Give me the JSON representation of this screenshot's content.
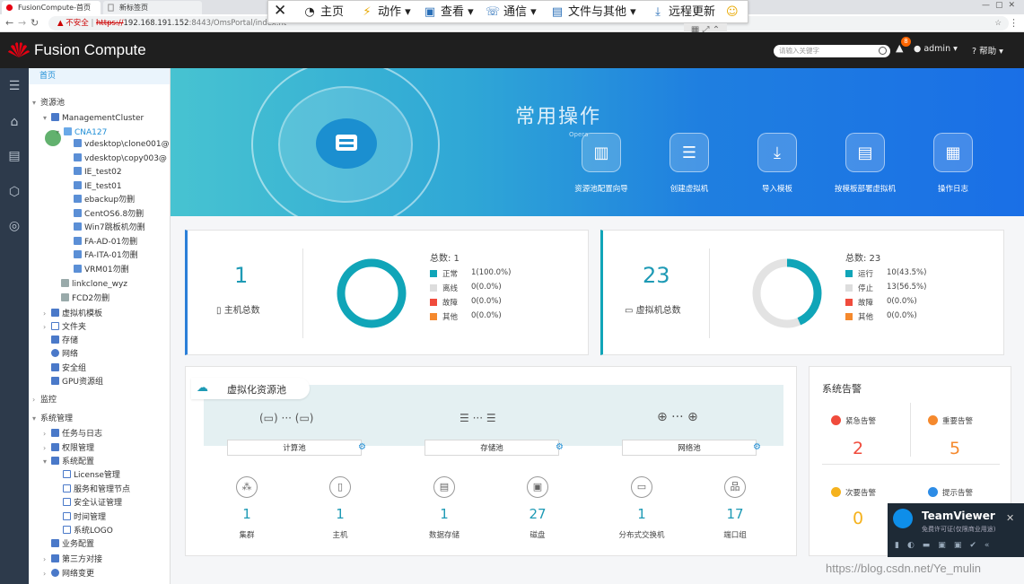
{
  "browser": {
    "tab1": "FusionCompute-首页",
    "tab2": "新标签页",
    "insecure": "不安全",
    "url_scheme": "https://",
    "url_host": "192.168.191.152",
    "url_rest": ":8443/OmsPortal/index.ht"
  },
  "remote_toolbar": {
    "home": "主页",
    "action": "动作",
    "view": "查看",
    "comm": "通信",
    "files": "文件与其他",
    "update": "远程更新"
  },
  "header": {
    "logo": "Fusion Compute",
    "search_placeholder": "请输入关键字",
    "alert_count": "8",
    "user": "admin",
    "help": "帮助"
  },
  "sidebar": {
    "home": "首页",
    "resource_pool": "资源池",
    "cluster": "ManagementCluster",
    "host": "CNA127",
    "vms": [
      "vdesktop\\clone001@",
      "vdesktop\\copy003@",
      "IE_test02",
      "IE_test01",
      "ebackup勿删",
      "CentOS6.8勿删",
      "Win7跳板机勿删",
      "FA-AD-01勿删",
      "FA-ITA-01勿删",
      "VRM01勿删"
    ],
    "linked": [
      "linkclone_wyz",
      "FCD2勿删"
    ],
    "pool_items": [
      "虚拟机模板",
      "文件夹",
      "存储",
      "网络",
      "安全组",
      "GPU资源组"
    ],
    "monitor": "监控",
    "sysmgmt": "系统管理",
    "sys_items": [
      "任务与日志",
      "权限管理",
      "系统配置"
    ],
    "config_items": [
      "License管理",
      "服务和管理节点",
      "安全认证管理",
      "时间管理",
      "系统LOGO"
    ],
    "sys_items2": [
      "业务配置",
      "第三方对接",
      "网络变更"
    ]
  },
  "banner": {
    "title": "常用操作",
    "subtitle": "Opera",
    "actions": [
      "资源池配置向导",
      "创建虚拟机",
      "导入模板",
      "按模板部署虚拟机",
      "操作日志"
    ]
  },
  "hosts": {
    "total": "1",
    "label": "主机总数",
    "sum": "总数: 1",
    "legend": [
      {
        "name": "正常",
        "value": "1(100.0%)",
        "color": "#10a5b8"
      },
      {
        "name": "离线",
        "value": "0(0.0%)",
        "color": "#dddddd"
      },
      {
        "name": "故障",
        "value": "0(0.0%)",
        "color": "#f04b3c"
      },
      {
        "name": "其他",
        "value": "0(0.0%)",
        "color": "#f5892d"
      }
    ]
  },
  "vms": {
    "total": "23",
    "label": "虚拟机总数",
    "sum": "总数: 23",
    "legend": [
      {
        "name": "运行",
        "value": "10(43.5%)",
        "color": "#10a5b8"
      },
      {
        "name": "停止",
        "value": "13(56.5%)",
        "color": "#dddddd"
      },
      {
        "name": "故障",
        "value": "0(0.0%)",
        "color": "#f04b3c"
      },
      {
        "name": "其他",
        "value": "0(0.0%)",
        "color": "#f5892d"
      }
    ],
    "running_fraction": 0.435
  },
  "pool": {
    "title": "虚拟化资源池",
    "groups": [
      "计算池",
      "存储池",
      "网络池"
    ],
    "items": [
      {
        "num": "1",
        "label": "集群"
      },
      {
        "num": "1",
        "label": "主机"
      },
      {
        "num": "1",
        "label": "数据存储"
      },
      {
        "num": "27",
        "label": "磁盘"
      },
      {
        "num": "1",
        "label": "分布式交换机"
      },
      {
        "num": "17",
        "label": "端口组"
      }
    ]
  },
  "alarms": {
    "title": "系统告警",
    "critical": {
      "label": "紧急告警",
      "count": "2",
      "color": "#f04b3c"
    },
    "major": {
      "label": "重要告警",
      "count": "5",
      "color": "#f5892d"
    },
    "minor": {
      "label": "次要告警",
      "count": "0",
      "color": "#f5b21d"
    },
    "info": {
      "label": "提示告警",
      "color": "#2d8ce6"
    }
  },
  "teamviewer": {
    "name": "TeamViewer",
    "sub": "免费许可证(仅限商业用途)"
  },
  "watermark": "https://blog.csdn.net/Ye_mulin"
}
